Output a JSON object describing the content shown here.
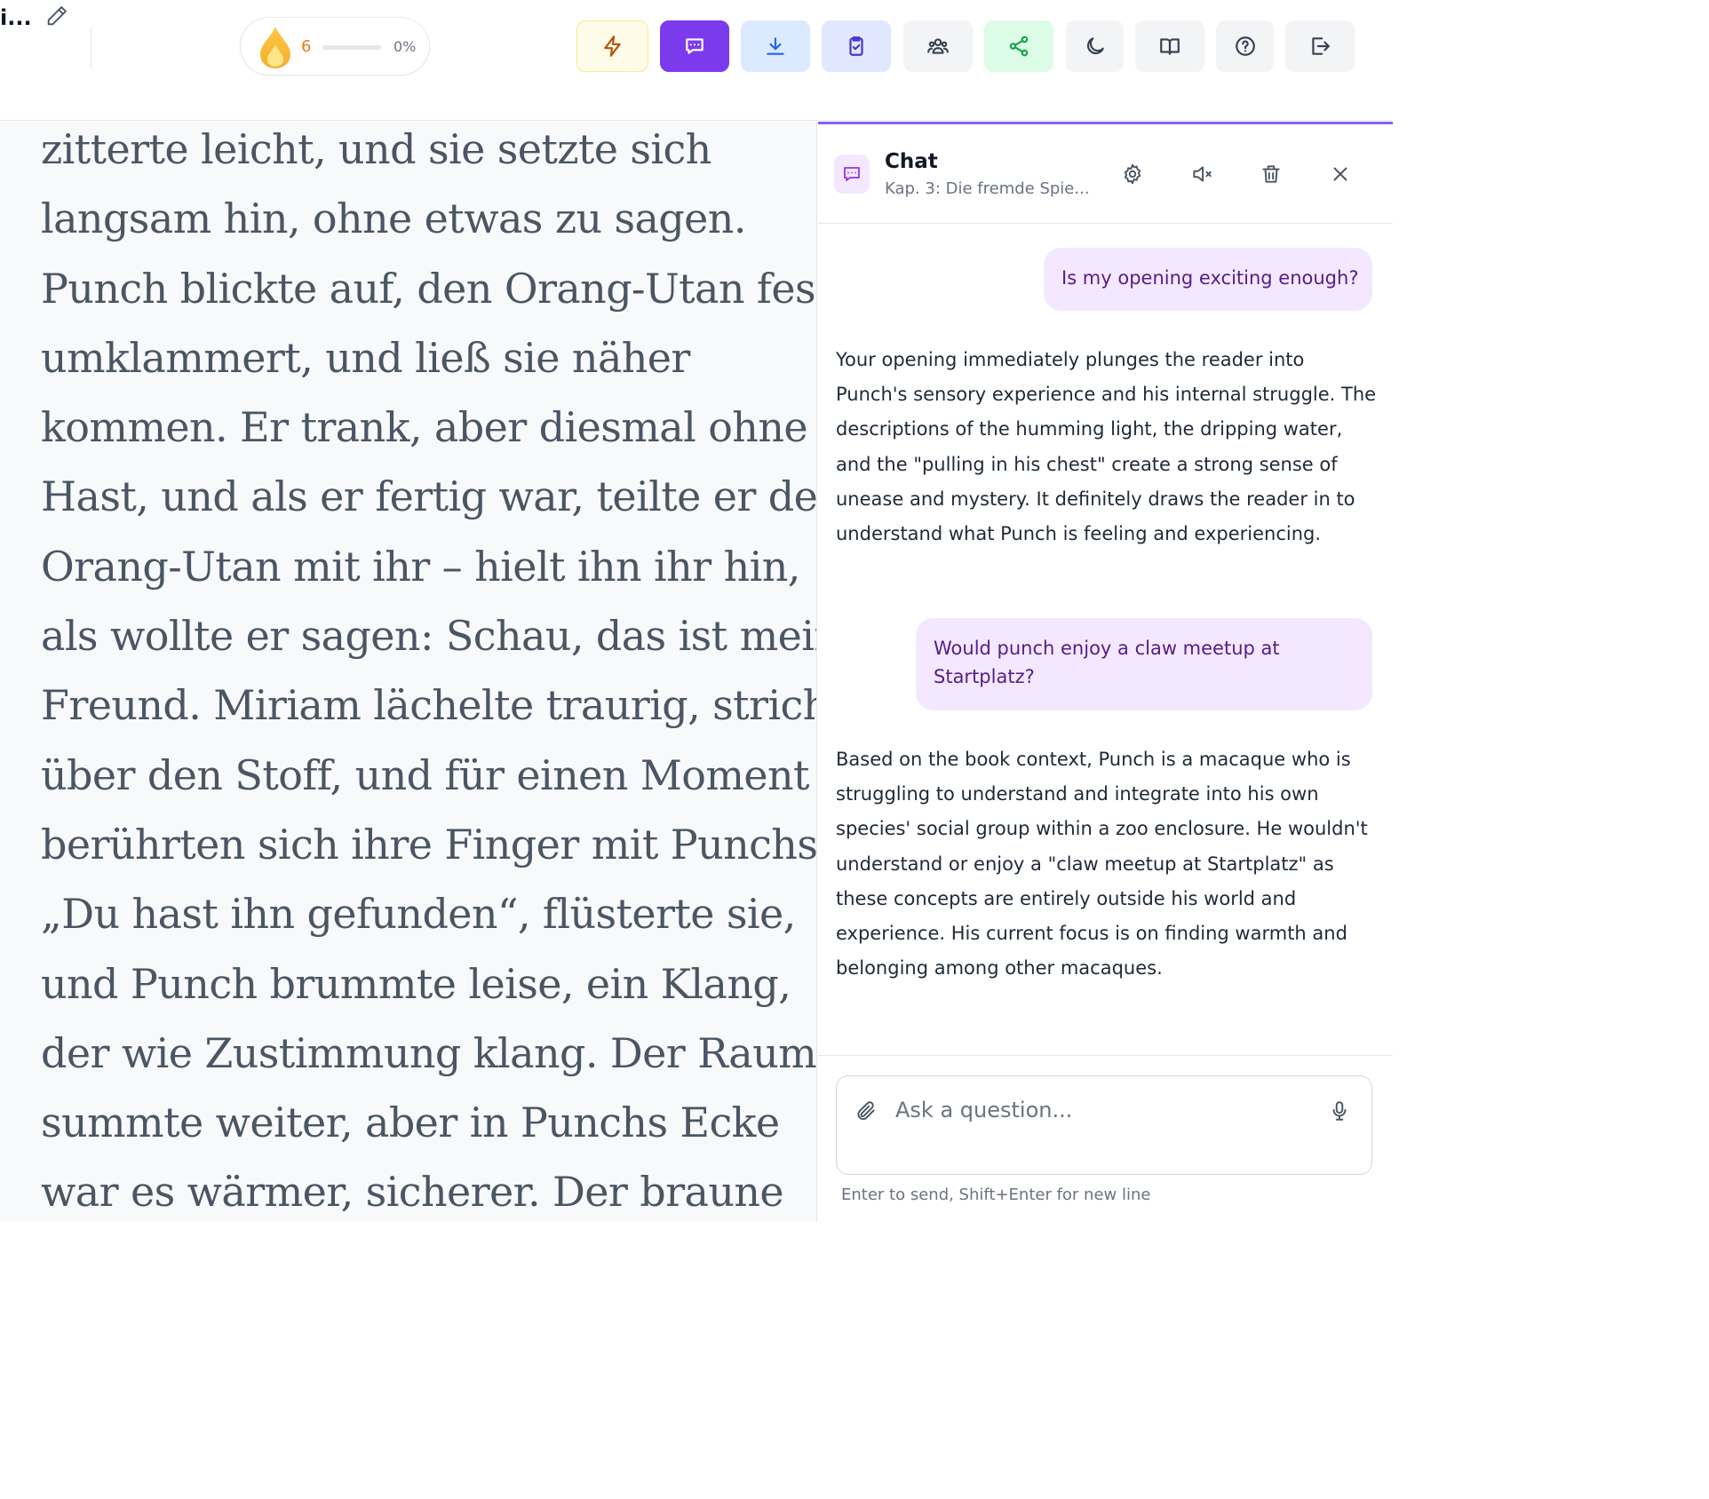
{
  "header": {
    "doc_title": "i...",
    "streak_count": "6",
    "progress_percent": "0%",
    "progress_value": 0
  },
  "toolbar": {
    "buttons": [
      {
        "name": "lightning-icon",
        "bg": "#fefce8",
        "border": "#fde68a",
        "stroke": "#b45309"
      },
      {
        "name": "chat-icon",
        "bg": "#7c3aed",
        "border": "#7c3aed",
        "stroke": "#ffffff"
      },
      {
        "name": "download-icon",
        "bg": "#dbeafe",
        "border": "#dbeafe",
        "stroke": "#2563eb"
      },
      {
        "name": "clipboard-check-icon",
        "bg": "#e0e7ff",
        "border": "#e0e7ff",
        "stroke": "#4338ca"
      },
      {
        "name": "users-icon",
        "bg": "#f3f4f6",
        "border": "#f3f4f6",
        "stroke": "#374151"
      },
      {
        "name": "share-icon",
        "bg": "#dcfce7",
        "border": "#dcfce7",
        "stroke": "#16a34a"
      },
      {
        "name": "moon-icon",
        "bg": "#f3f4f6",
        "border": "#f3f4f6",
        "stroke": "#374151"
      },
      {
        "name": "book-icon",
        "bg": "#f3f4f6",
        "border": "#f3f4f6",
        "stroke": "#374151"
      },
      {
        "name": "help-icon",
        "bg": "#f3f4f6",
        "border": "#f3f4f6",
        "stroke": "#374151"
      },
      {
        "name": "logout-icon",
        "bg": "#f3f4f6",
        "border": "#f3f4f6",
        "stroke": "#374151"
      }
    ]
  },
  "reader": {
    "lines": [
      "zitterte leicht, und sie setzte sich",
      "langsam hin, ohne etwas zu sagen.",
      "Punch blickte auf, den Orang-Utan fest",
      "umklammert, und ließ sie näher",
      "kommen. Er trank, aber diesmal ohne",
      "Hast, und als er fertig war, teilte er den",
      "Orang-Utan mit ihr – hielt ihn ihr hin,",
      "als wollte er sagen: Schau, das ist mein",
      "Freund. Miriam lächelte traurig, strich",
      "über den Stoff, und für einen Moment",
      "berührten sich ihre Finger mit Punchs.",
      "„Du hast ihn gefunden“, flüsterte sie,",
      "und Punch brummte leise, ein Klang,",
      "der wie Zustimmung klang. Der Raum",
      "summte weiter, aber in Punchs Ecke",
      "war es wärmer, sicherer. Der braune"
    ]
  },
  "chat": {
    "title": "Chat",
    "subtitle": "Kap. 3: Die fremde Spie...",
    "messages": {
      "user1": "Is my opening exciting enough?",
      "ai1": "Your opening immediately plunges the reader into Punch's sensory experience and his internal struggle. The descriptions of the humming light, the dripping water, and the \"pulling in his chest\" create a strong sense of unease and mystery. It definitely draws the reader in to understand what Punch is feeling and experiencing.",
      "user2": "Would punch enjoy a claw meetup at Startplatz?",
      "ai2": "Based on the book context, Punch is a macaque who is struggling to understand and integrate into his own species' social group within a zoo enclosure. He wouldn't understand or enjoy a \"claw meetup at Startplatz\" as these concepts are entirely outside his world and experience. His current focus is on finding warmth and belonging among other macaques."
    },
    "input_placeholder": "Ask a question...",
    "input_value": "",
    "hint": "Enter to send, Shift+Enter for new line"
  },
  "colors": {
    "accent": "#7c3aed",
    "accent_light": "#f3e8ff",
    "streak": "#ea7a1e"
  }
}
